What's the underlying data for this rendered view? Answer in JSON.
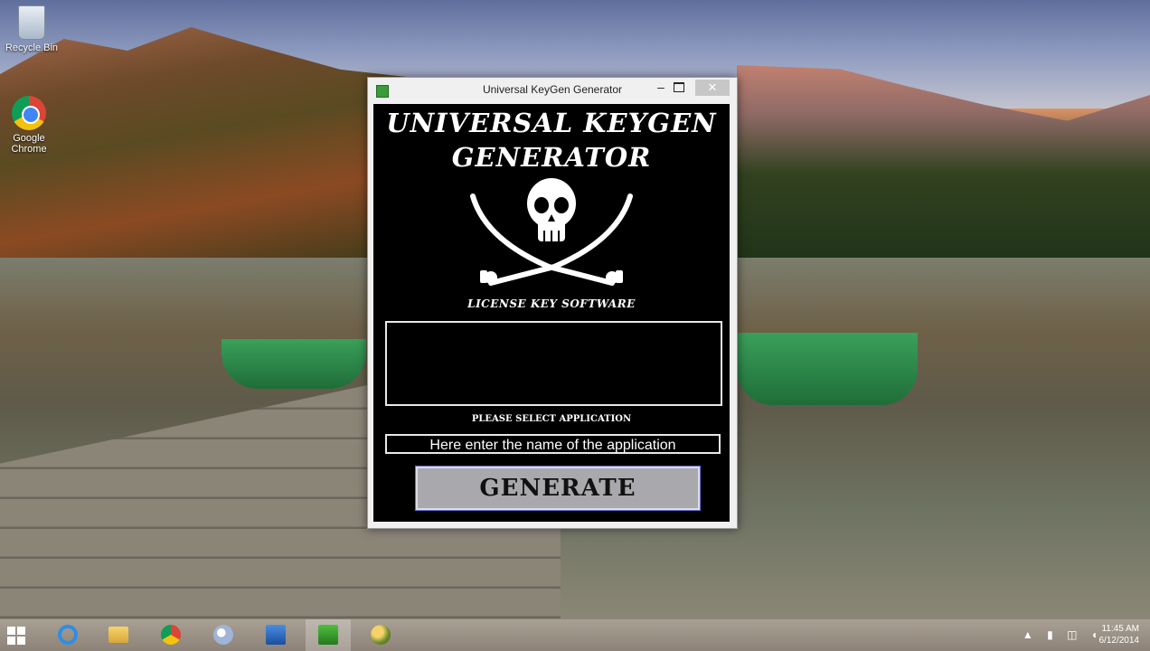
{
  "desktop": {
    "icons": [
      {
        "label": "Recycle Bin",
        "icon": "recycle-bin-icon"
      },
      {
        "label": "Google\nChrome",
        "icon": "chrome-icon"
      }
    ]
  },
  "window": {
    "title": "Universal KeyGen Generator",
    "minimize_glyph": "–",
    "close_glyph": "✕",
    "heading_line1": "UNIVERSAL KEYGEN",
    "heading_line2": "GENERATOR",
    "subheading": "LICENSE KEY SOFTWARE",
    "output_value": "",
    "select_label": "PLEASE SELECT APPLICATION",
    "app_input_value": "Here enter the name of the application",
    "generate_label": "GENERATE"
  },
  "taskbar": {
    "items": [
      "start-icon",
      "internet-explorer-icon",
      "file-explorer-icon",
      "chrome-icon",
      "paint-icon",
      "network-app-icon",
      "keygen-app-icon",
      "ball-app-icon"
    ],
    "tray_glyphs": "▲ ▮ ◫ ◖",
    "time": "11:45 AM",
    "date": "6/12/2014"
  },
  "colors": {
    "window_client_bg": "#000000",
    "generate_button_bg": "#a9a9ad",
    "close_button_bg": "#c7c7c7"
  }
}
